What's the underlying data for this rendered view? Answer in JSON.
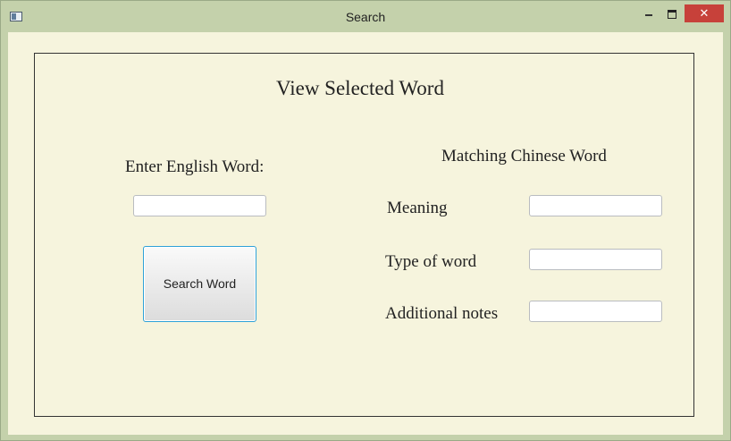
{
  "window": {
    "title": "Search",
    "minimize_glyph": "minimize-icon",
    "maximize_glyph": "maximize-icon",
    "close_label": "✕"
  },
  "form": {
    "heading": "View Selected Word",
    "english_label": "Enter English Word:",
    "english_value": "",
    "search_button_label": "Search Word",
    "matching_heading": "Matching Chinese Word",
    "meaning_label": "Meaning",
    "meaning_value": "",
    "type_label": "Type of word",
    "type_value": "",
    "notes_label": "Additional notes",
    "notes_value": ""
  },
  "colors": {
    "frame": "#c4d1ab",
    "client_bg": "#f6f4dd",
    "close_button": "#c7413a",
    "button_focus_border": "#2ea1d8"
  }
}
